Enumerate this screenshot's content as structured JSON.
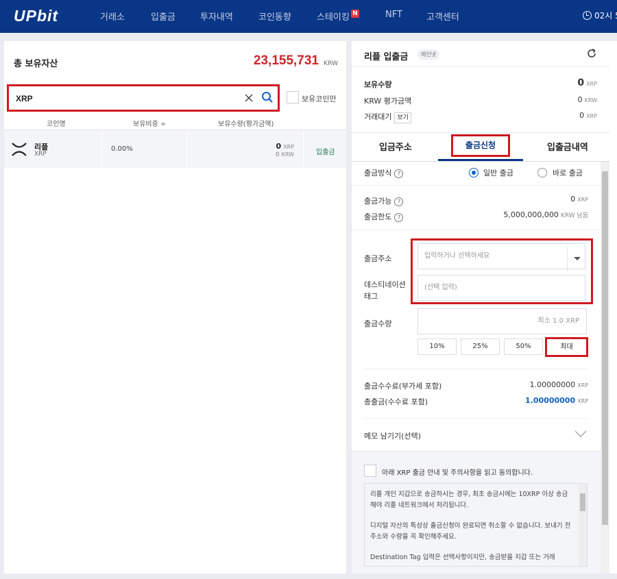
{
  "nav": {
    "logo": "UPbit",
    "items": [
      "거래소",
      "입출금",
      "투자내역",
      "코인동향",
      "스테이킹",
      "NFT",
      "고객센터"
    ],
    "badge": "N",
    "clock": "02시 5"
  },
  "assets": {
    "title": "총 보유자산",
    "total": "23,155,731",
    "unit": "KRW",
    "search_value": "XRP",
    "own_only_label": "보유코인만",
    "headers": [
      "코인명",
      "보유비중 ÷",
      "보유수량(평가금액)"
    ],
    "row": {
      "name": "리플",
      "symbol": "XRP",
      "ratio": "0.00%",
      "qty": "0",
      "qty_unit": "XRP",
      "krw": "0",
      "krw_unit": "KRW",
      "action": "입출금"
    }
  },
  "panel": {
    "title": "리플 입출금",
    "mainnet": "메인넷",
    "holding_label": "보유수량",
    "holding_value": "0",
    "holding_unit": "XRP",
    "krw_label": "KRW 평가금액",
    "krw_value": "0",
    "krw_unit": "KRW",
    "waiting_label": "거래대기",
    "view_btn": "보기",
    "waiting_value": "0",
    "waiting_unit": "XRP",
    "tabs": [
      "입금주소",
      "출금신청",
      "입출금내역"
    ],
    "form": {
      "method_label": "출금방식",
      "q": "?",
      "method_normal": "일반 출금",
      "method_instant": "바로 출금",
      "available_label": "출금가능",
      "available_value": "0",
      "available_unit": "XRP",
      "limit_label": "출금한도",
      "limit_value": "5,000,000,000",
      "limit_unit": "KRW 남음",
      "address_label": "출금주소",
      "address_placeholder": "입력하거나 선택하세요",
      "tag_label_1": "데스티네이션",
      "tag_label_2": "태그",
      "tag_placeholder": "(선택 입력)",
      "amount_label": "출금수량",
      "amount_placeholder": "최소 1.0 XRP",
      "pct": [
        "10%",
        "25%",
        "50%"
      ],
      "max": "최대",
      "fee_label": "출금수수료(부가세 포함)",
      "fee_value": "1.00000000",
      "fee_unit": "XRP",
      "total_label": "총출금(수수료 포함)",
      "total_value": "1.00000000",
      "total_unit": "XRP",
      "memo_label": "메모 남기기(선택)",
      "agree_label": "아래 XRP 출금 안내 및 주의사항을 읽고 동의합니다.",
      "notice_1": "리플 개인 지갑으로 송금하시는 경우, 최초 송금시에는 10XRP 이상 송금해야 리플 네트워크에서 처리됩니다.",
      "notice_2": "디지털 자산의 특성상 출금신청이 완료되면 취소할 수 없습니다. 보내기 전 주소와 수량을 꼭 확인해주세요.",
      "notice_3": "Destination Tag 입력은 선택사항이지만, 송금받을 지갑 또는 거래"
    }
  }
}
